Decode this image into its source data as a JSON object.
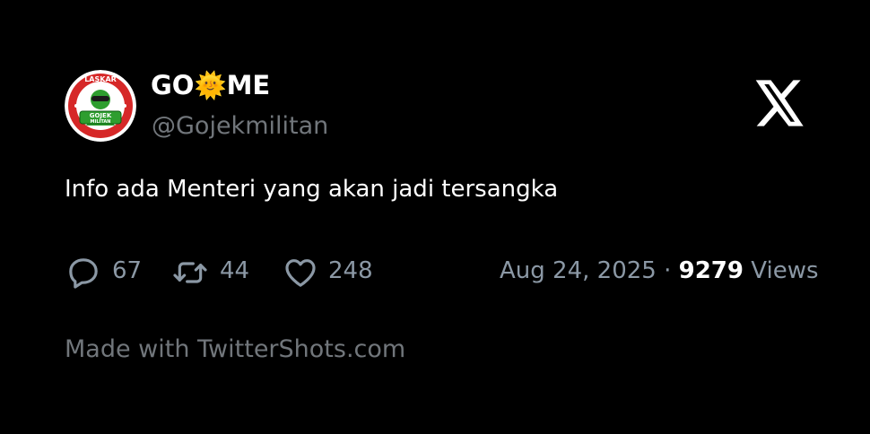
{
  "tweet": {
    "display_name": "GO🌞ME",
    "handle": "@Gojekmilitan",
    "text": "Info ada Menteri yang akan jadi tersangka",
    "replies": "67",
    "retweets": "44",
    "likes": "248",
    "date": "Aug 24, 2025",
    "separator": "·",
    "views_count": "9279",
    "views_label": "Views"
  },
  "avatar": {
    "icon": "gojek-militan-logo",
    "top_text": "LASKAR",
    "badge_line1": "GOJEK",
    "badge_line2": "MILITAN"
  },
  "brand": {
    "icon": "x-logo-icon"
  },
  "footer": {
    "text": "Made with TwitterShots.com"
  },
  "colors": {
    "background": "#000000",
    "text_primary": "#ffffff",
    "text_secondary": "#8b98a5",
    "brand_green": "#2e9e2f",
    "logo_red": "#d62828"
  }
}
